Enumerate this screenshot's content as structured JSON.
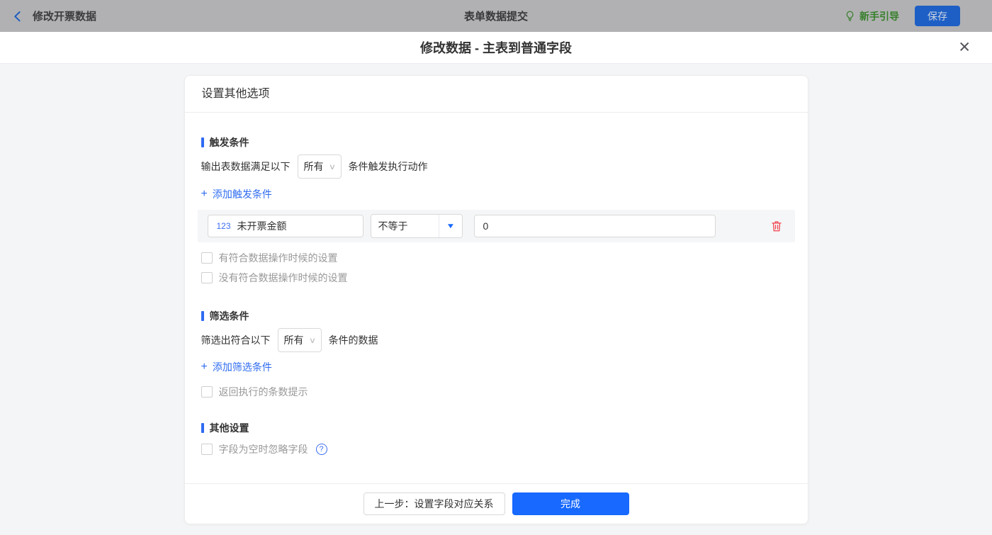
{
  "topbar": {
    "back_label": "修改开票数据",
    "title": "表单数据提交",
    "guide_label": "新手引导",
    "save_label": "保存"
  },
  "dialog": {
    "title": "修改数据 - 主表到普通字段",
    "card": {
      "header": "设置其他选项",
      "trigger": {
        "title": "触发条件",
        "prefix": "输出表数据满足以下",
        "match_value": "所有",
        "suffix": "条件触发执行动作",
        "add_link": "添加触发条件",
        "condition": {
          "field_tag": "123",
          "field_name": "未开票金额",
          "operator": "不等于",
          "value": "0"
        },
        "checkbox_has_match": "有符合数据操作时候的设置",
        "checkbox_no_match": "没有符合数据操作时候的设置"
      },
      "filter": {
        "title": "筛选条件",
        "prefix": "筛选出符合以下",
        "match_value": "所有",
        "suffix": "条件的数据",
        "add_link": "添加筛选条件",
        "checkbox_return": "返回执行的条数提示"
      },
      "other": {
        "title": "其他设置",
        "checkbox_ignore_empty": "字段为空时忽略字段"
      },
      "footer": {
        "prev_label": "上一步：设置字段对应关系",
        "done_label": "完成"
      }
    }
  },
  "icons": {
    "plus": "+",
    "caret_down": "∨",
    "caret_filled": "▼",
    "close": "✕",
    "question": "?"
  },
  "colors": {
    "accent_blue": "#1769ff",
    "link_blue": "#2f6cf0",
    "section_bar_blue": "#2e6bf2",
    "success_green": "#377f2b",
    "danger_red": "#f0414b",
    "topbar_dimmed_gray": "#b1b1b3"
  }
}
